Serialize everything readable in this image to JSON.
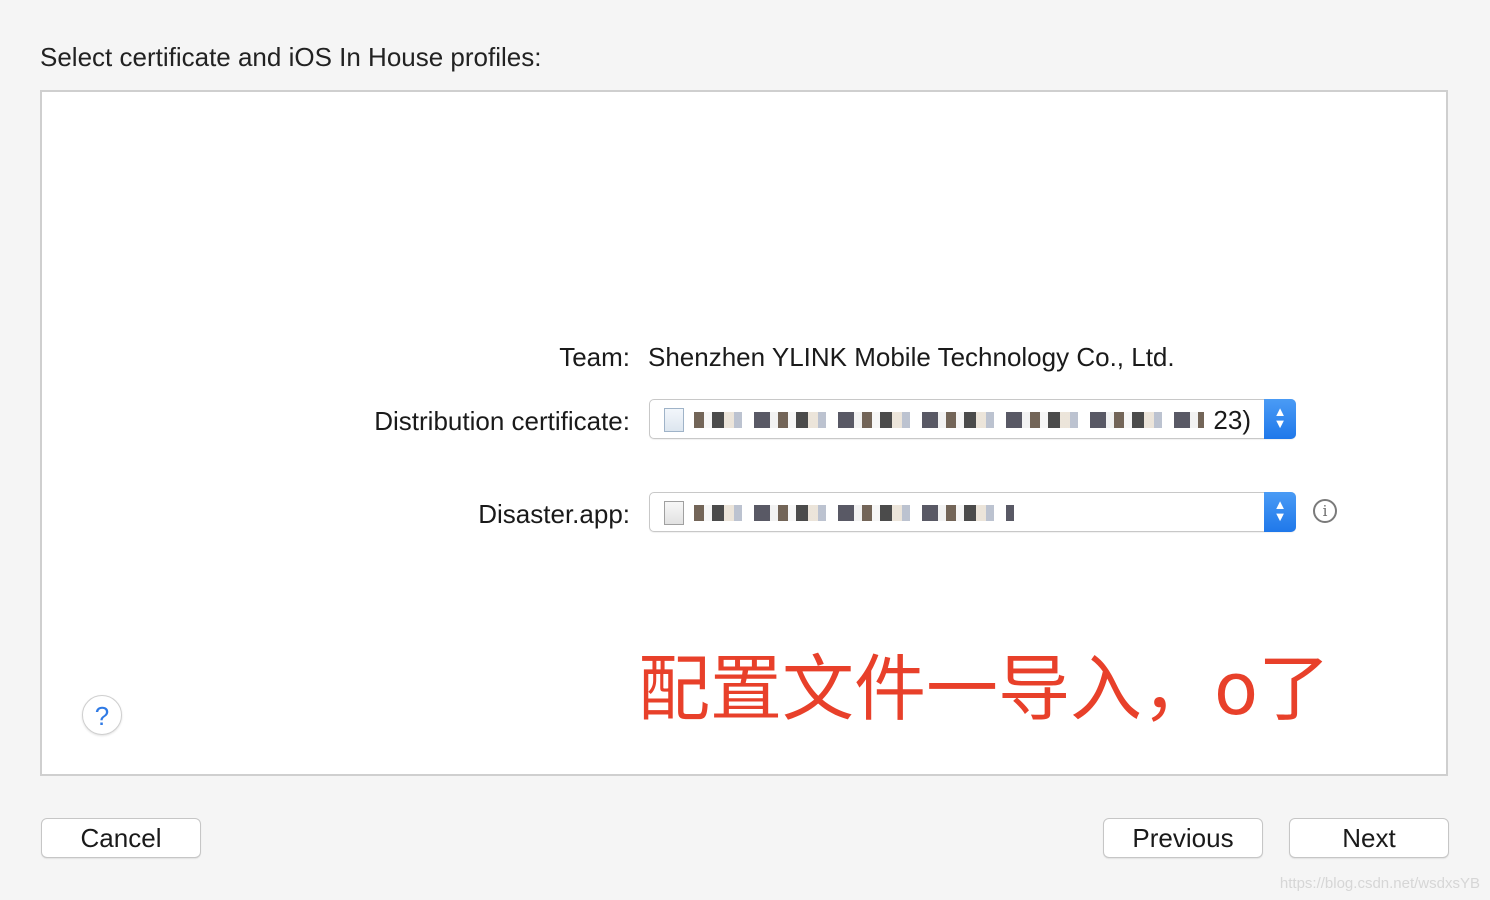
{
  "dialog": {
    "heading": "Select certificate and iOS In House profiles:"
  },
  "form": {
    "team_label": "Team:",
    "team_value": "Shenzhen YLINK Mobile Technology Co., Ltd.",
    "certificate_label": "Distribution certificate:",
    "certificate_value_visible_suffix": "23)",
    "app_label": "Disaster.app:",
    "app_profile_value_visible": ""
  },
  "annotation": {
    "text": "配置文件一导入，o了",
    "color": "#e8402a"
  },
  "buttons": {
    "help": "?",
    "cancel": "Cancel",
    "previous": "Previous",
    "next": "Next"
  },
  "icons": {
    "stepper_up": "▲",
    "stepper_down": "▼",
    "info": "i"
  },
  "watermark": "https://blog.csdn.net/wsdxsYB",
  "colors": {
    "accent": "#2f7ae5",
    "stepper": "#1f78ea",
    "annotation": "#e8402a"
  }
}
